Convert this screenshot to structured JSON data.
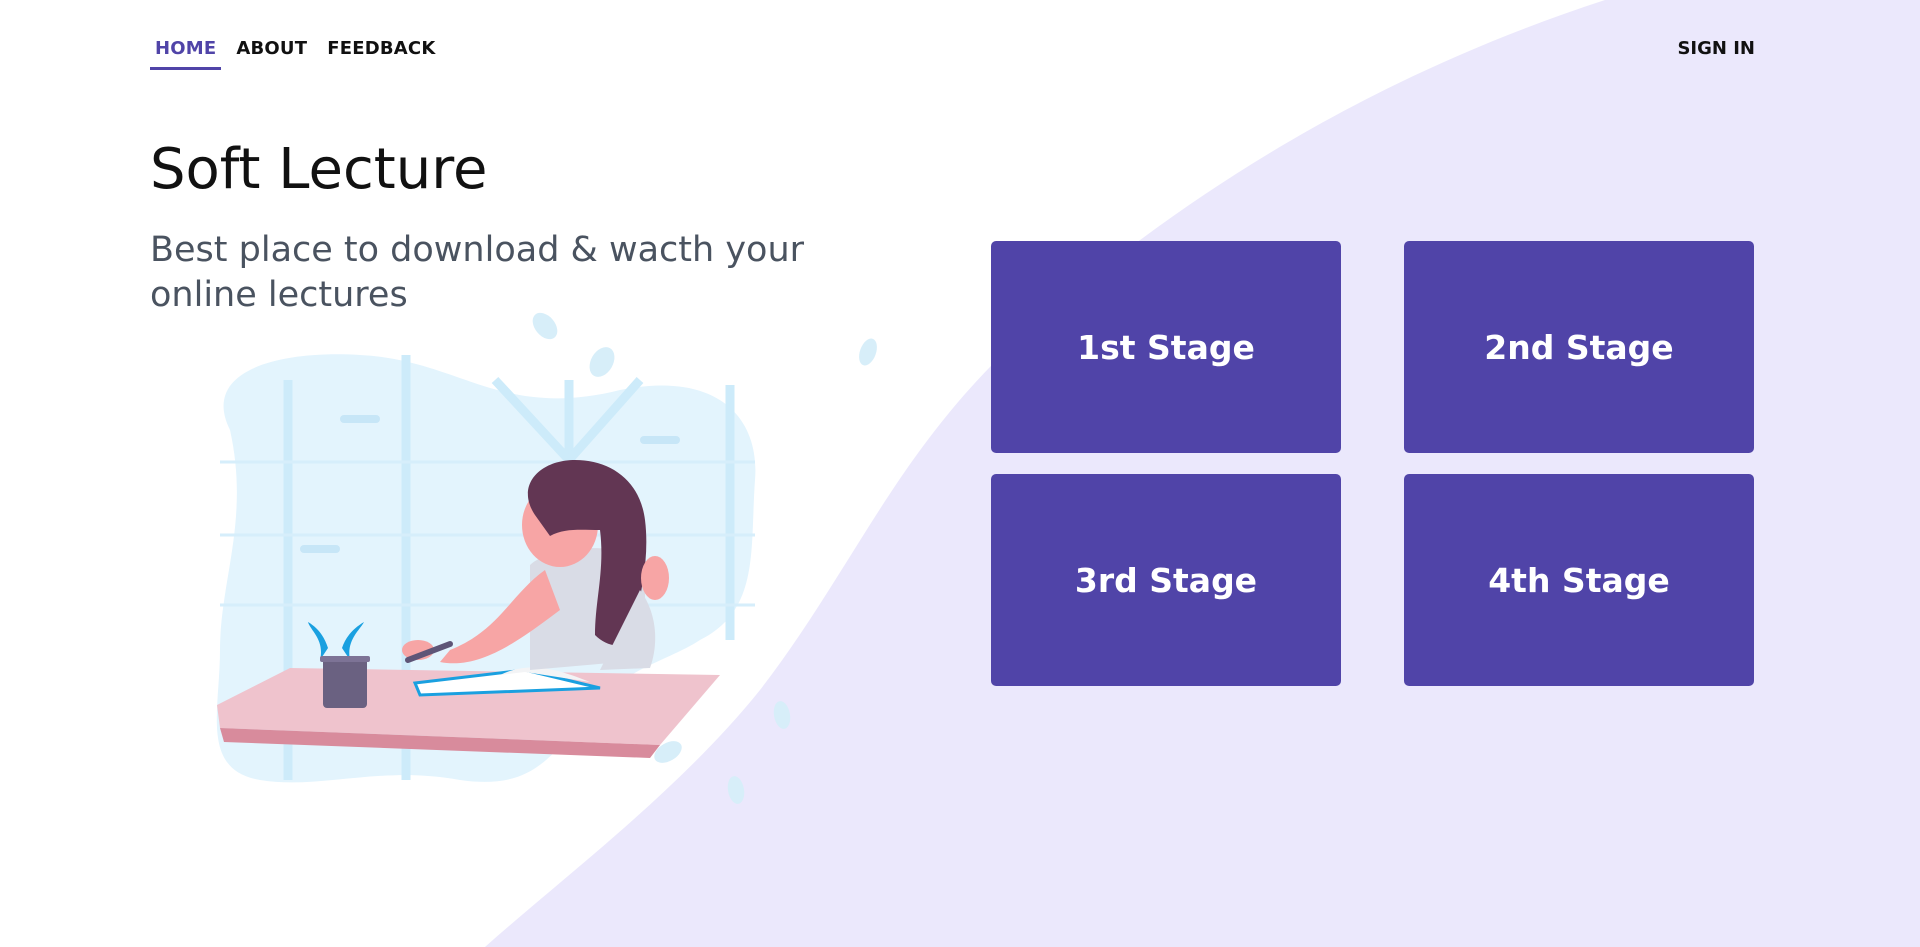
{
  "nav": {
    "items": [
      {
        "label": "HOME",
        "active": true
      },
      {
        "label": "ABOUT",
        "active": false
      },
      {
        "label": "FEEDBACK",
        "active": false
      }
    ],
    "signin_label": "SIGN IN"
  },
  "hero": {
    "title": "Soft Lecture",
    "subtitle": "Best place to download & wacth your online lectures"
  },
  "stages": [
    {
      "label": "1st Stage"
    },
    {
      "label": "2nd Stage"
    },
    {
      "label": "3rd Stage"
    },
    {
      "label": "4th Stage"
    }
  ],
  "colors": {
    "accent": "#5044a8",
    "background_wave": "#ebe8fc",
    "illustration_blob": "#e3f4fd"
  }
}
